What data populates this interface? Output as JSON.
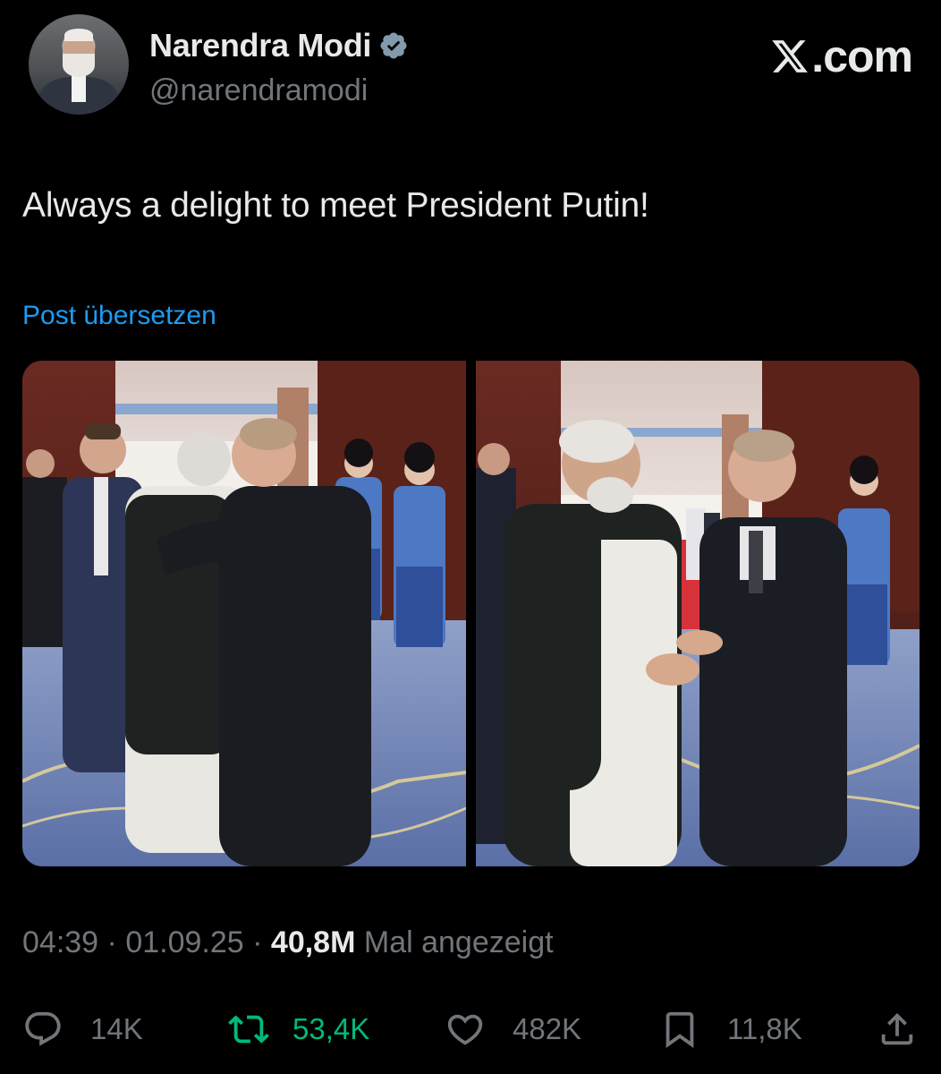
{
  "author": {
    "name": "Narendra Modi",
    "handle": "@narendramodi",
    "verified": true
  },
  "brand": {
    "label": ".com"
  },
  "tweet": {
    "text": "Always a delight to meet President Putin!",
    "translate_label": "Post übersetzen"
  },
  "meta": {
    "time": "04:39",
    "separator": "·",
    "date": "01.09.25",
    "views": "40,8M",
    "views_suffix": "Mal angezeigt"
  },
  "actions": {
    "replies": "14K",
    "reposts": "53,4K",
    "likes": "482K",
    "bookmarks": "11,8K"
  },
  "colors": {
    "background": "#000000",
    "text": "#e7e9ea",
    "muted": "#71767b",
    "link": "#1d9bf0",
    "repost": "#00ba7c",
    "verified": "#829aab"
  }
}
